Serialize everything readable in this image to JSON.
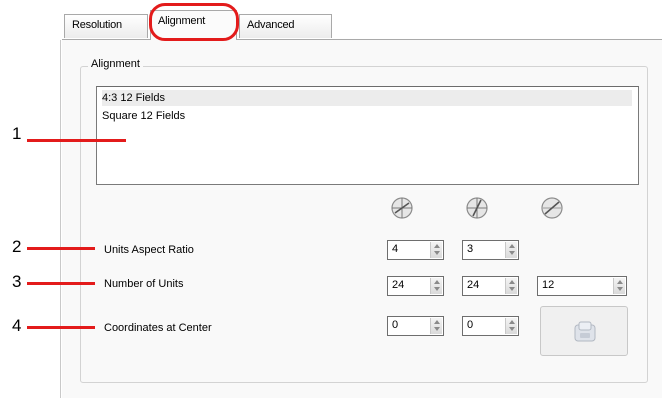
{
  "tabs": [
    {
      "label": "Resolution"
    },
    {
      "label": "Alignment",
      "active": true
    },
    {
      "label": "Advanced"
    }
  ],
  "group": {
    "title": "Alignment",
    "list_items": [
      {
        "label": "4:3 12 Fields",
        "selected": true
      },
      {
        "label": "Square 12 Fields",
        "selected": false
      }
    ]
  },
  "axis_icons": [
    "x-axis-icon",
    "y-axis-icon",
    "z-axis-icon"
  ],
  "rows": {
    "aspect_ratio": {
      "label": "Units Aspect Ratio",
      "values": [
        "4",
        "3"
      ]
    },
    "num_units": {
      "label": "Number of Units",
      "values": [
        "24",
        "24",
        "12"
      ]
    },
    "coords_center": {
      "label": "Coordinates at Center",
      "values": [
        "0",
        "0"
      ]
    }
  },
  "callouts": [
    "1",
    "2",
    "3",
    "4"
  ],
  "colors": {
    "callout": "#e31b1b",
    "highlight_ring": "#e31b1b"
  }
}
